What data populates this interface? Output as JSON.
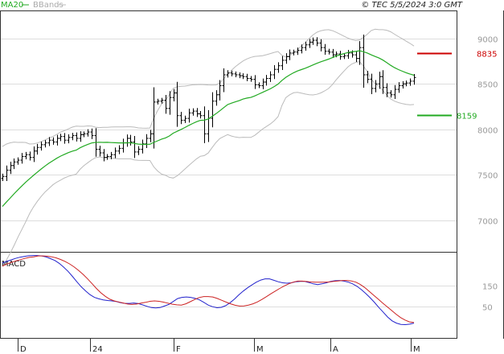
{
  "header": {
    "legend_ma": "MA20",
    "legend_bb": "BBands",
    "copyright": "© TEC 5/5/2024 3:0 GMT"
  },
  "colors": {
    "ma": "#22aa22",
    "bbands": "#bbbbbb",
    "bars": "#000000",
    "resistance": "#cc0000",
    "support": "#22aa22",
    "macd": "#2222cc",
    "signal": "#cc2222",
    "grid": "#dddddd"
  },
  "chart_data": [
    {
      "type": "ohlc",
      "x_labels": [
        "D",
        "24",
        "F",
        "M",
        "A",
        "M"
      ],
      "y_ticks": [
        7000,
        7500,
        8000,
        8500,
        9000
      ],
      "y_tick_labels": [
        "7000",
        "7500",
        "8000",
        "8500",
        "9000"
      ],
      "ylim": [
        6650,
        9300
      ],
      "grid": true,
      "levels": [
        {
          "label": "8835",
          "value": 8835,
          "role": "resistance"
        },
        {
          "label": "8159",
          "value": 8159,
          "role": "support"
        }
      ],
      "series": [
        {
          "name": "MA20",
          "kind": "ma"
        },
        {
          "name": "BBands",
          "kind": "bbands"
        }
      ],
      "close": [
        7480,
        7550,
        7600,
        7640,
        7660,
        7700,
        7720,
        7690,
        7760,
        7800,
        7830,
        7850,
        7880,
        7860,
        7900,
        7920,
        7880,
        7910,
        7930,
        7900,
        7940,
        7950,
        7970,
        7930,
        7780,
        7740,
        7690,
        7700,
        7720,
        7760,
        7790,
        7850,
        7900,
        7860,
        7750,
        7780,
        7840,
        7900,
        7950,
        8300,
        8310,
        8320,
        8230,
        8350,
        8400,
        8150,
        8100,
        8120,
        8180,
        8200,
        8170,
        8150,
        7950,
        8120,
        8310,
        8380,
        8480,
        8600,
        8620,
        8610,
        8600,
        8590,
        8580,
        8560,
        8550,
        8490,
        8480,
        8520,
        8560,
        8600,
        8660,
        8700,
        8760,
        8800,
        8840,
        8850,
        8870,
        8900,
        8930,
        8960,
        8980,
        8950,
        8900,
        8860,
        8850,
        8820,
        8830,
        8800,
        8810,
        8840,
        8820,
        8780,
        8900,
        8600,
        8550,
        8450,
        8500,
        8580,
        8460,
        8400,
        8380,
        8440,
        8480,
        8500,
        8510,
        8530,
        8570
      ]
    },
    {
      "type": "line",
      "title": "MACD",
      "y_ticks": [
        150,
        50
      ],
      "y_tick_labels": [
        "150",
        "50"
      ],
      "ylim": [
        -100,
        310
      ],
      "series": [
        {
          "name": "MACD",
          "kind": "macd",
          "values": [
            260,
            268,
            275,
            282,
            288,
            292,
            295,
            296,
            296,
            294,
            289,
            281,
            272,
            258,
            240,
            220,
            196,
            170,
            146,
            126,
            108,
            95,
            88,
            83,
            80,
            78,
            75,
            69,
            66,
            66,
            68,
            65,
            59,
            52,
            46,
            44,
            46,
            53,
            61,
            75,
            89,
            95,
            97,
            95,
            90,
            83,
            71,
            58,
            50,
            45,
            47,
            55,
            69,
            87,
            107,
            125,
            141,
            155,
            168,
            178,
            184,
            184,
            177,
            170,
            165,
            163,
            165,
            170,
            172,
            172,
            166,
            160,
            156,
            160,
            165,
            172,
            175,
            176,
            173,
            168,
            160,
            148,
            132,
            113,
            93,
            70,
            46,
            23,
            0,
            -18,
            -29,
            -35,
            -36,
            -34,
            -29
          ]
        },
        {
          "name": "Signal",
          "kind": "signal",
          "values": [
            245,
            255,
            263,
            270,
            276,
            282,
            287,
            290,
            294,
            294,
            293,
            290,
            285,
            277,
            268,
            256,
            242,
            225,
            206,
            185,
            162,
            138,
            117,
            100,
            86,
            78,
            73,
            68,
            63,
            61,
            63,
            67,
            71,
            76,
            78,
            76,
            72,
            67,
            62,
            59,
            58,
            64,
            74,
            85,
            94,
            99,
            99,
            97,
            90,
            81,
            72,
            64,
            57,
            53,
            54,
            58,
            64,
            73,
            85,
            98,
            112,
            125,
            138,
            150,
            160,
            168,
            173,
            173,
            171,
            169,
            168,
            168,
            168,
            169,
            172,
            174,
            176,
            176,
            174,
            168,
            157,
            142,
            124,
            105,
            87,
            68,
            50,
            32,
            14,
            -2,
            -14,
            -23,
            -26
          ]
        }
      ]
    }
  ]
}
